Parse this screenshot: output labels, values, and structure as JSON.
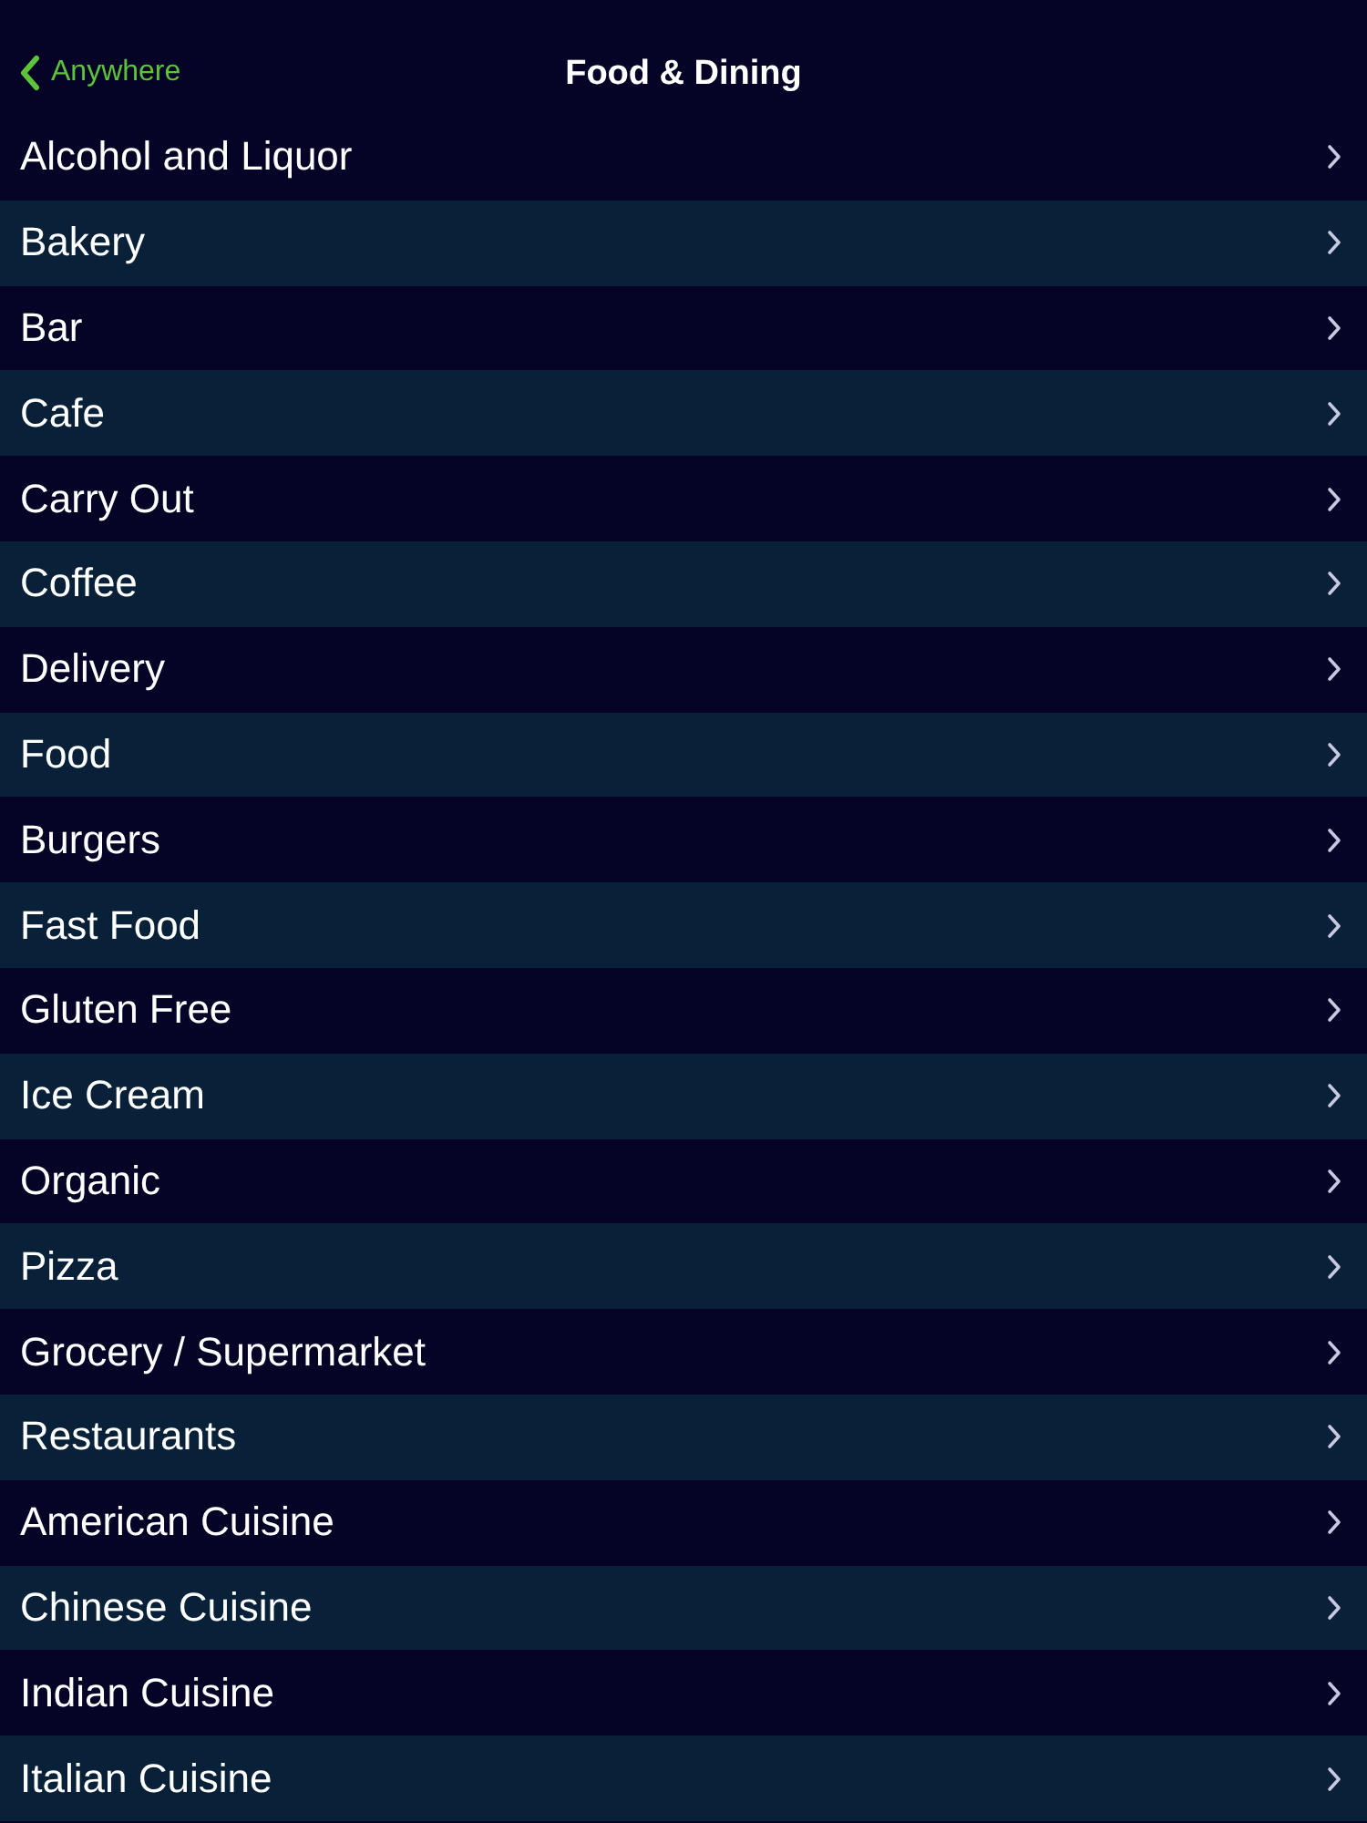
{
  "nav": {
    "back": "Anywhere",
    "title": "Food & Dining"
  },
  "items": [
    {
      "label": "Alcohol and Liquor"
    },
    {
      "label": "Bakery"
    },
    {
      "label": "Bar"
    },
    {
      "label": "Cafe"
    },
    {
      "label": "Carry Out"
    },
    {
      "label": "Coffee"
    },
    {
      "label": "Delivery"
    },
    {
      "label": "Food"
    },
    {
      "label": "Burgers"
    },
    {
      "label": "Fast Food"
    },
    {
      "label": "Gluten Free"
    },
    {
      "label": "Ice Cream"
    },
    {
      "label": "Organic"
    },
    {
      "label": "Pizza"
    },
    {
      "label": "Grocery / Supermarket"
    },
    {
      "label": "Restaurants"
    },
    {
      "label": "American Cuisine"
    },
    {
      "label": "Chinese Cuisine"
    },
    {
      "label": "Indian Cuisine"
    },
    {
      "label": "Italian Cuisine"
    }
  ]
}
